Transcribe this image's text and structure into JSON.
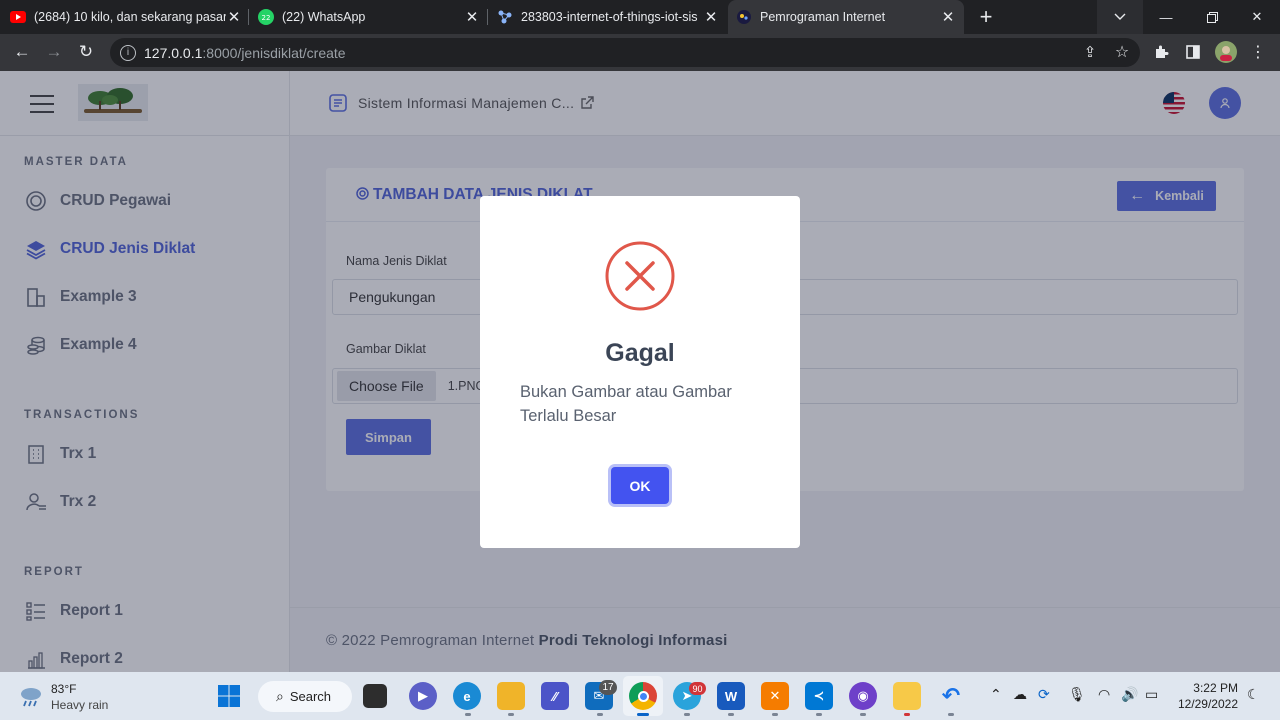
{
  "browser": {
    "tabs": [
      {
        "title": "(2684) 10 kilo, dan sekarang pasar",
        "icon": "youtube-icon"
      },
      {
        "title": "(22) WhatsApp",
        "icon": "whatsapp-icon"
      },
      {
        "title": "283803-internet-of-things-iot-sis",
        "icon": "iot-icon"
      },
      {
        "title": "Pemrograman Internet",
        "icon": "site-icon"
      }
    ],
    "url_host": "127.0.0.1",
    "url_path": ":8000/jenisdiklat/create"
  },
  "app": {
    "header_title": "Sistem Informasi Manajemen C...",
    "sections": [
      {
        "label": "MASTER DATA",
        "items": [
          {
            "label": "CRUD Pegawai",
            "icon": "layers-icon"
          },
          {
            "label": "CRUD Jenis Diklat",
            "icon": "stack-icon",
            "active": true
          },
          {
            "label": "Example 3",
            "icon": "building-icon"
          },
          {
            "label": "Example 4",
            "icon": "coins-icon"
          }
        ]
      },
      {
        "label": "TRANSACTIONS",
        "items": [
          {
            "label": "Trx 1",
            "icon": "office-icon"
          },
          {
            "label": "Trx 2",
            "icon": "user-list-icon"
          }
        ]
      },
      {
        "label": "REPORT",
        "items": [
          {
            "label": "Report 1",
            "icon": "list-icon"
          },
          {
            "label": "Report 2",
            "icon": "bar-chart-icon"
          }
        ]
      }
    ],
    "form": {
      "title": "TAMBAH DATA JENIS DIKLAT",
      "back_button": "Kembali",
      "name_label": "Nama Jenis Diklat",
      "name_value": "Pengukungan",
      "image_label": "Gambar Diklat",
      "choose_file": "Choose File",
      "file_name": "1.PNG",
      "submit": "Simpan"
    },
    "footer": {
      "text": "© 2022 Pemrograman Internet",
      "bold": "Prodi Teknologi Informasi"
    }
  },
  "dialog": {
    "title": "Gagal",
    "message": "Bukan Gambar atau Gambar Terlalu Besar",
    "ok": "OK",
    "colors": {
      "error": "#e0574a",
      "ok": "#4353f0"
    }
  },
  "taskbar": {
    "weather_temp": "83°F",
    "weather_desc": "Heavy rain",
    "search": "Search",
    "mail_badge": "17",
    "telegram_badge": "90",
    "time": "3:22 PM",
    "date": "12/29/2022"
  }
}
